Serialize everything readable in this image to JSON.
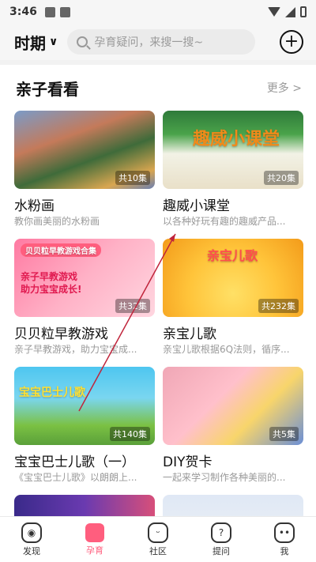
{
  "status": {
    "time": "3:46"
  },
  "topbar": {
    "period_label": "时期",
    "search_placeholder": "孕育疑问，来搜一搜~"
  },
  "section": {
    "title": "亲子看看",
    "more_label": "更多"
  },
  "cards": [
    {
      "title": "水粉画",
      "subtitle": "教你画美丽的水粉画",
      "badge": "共10集"
    },
    {
      "title": "趣威小课堂",
      "subtitle": "以各种好玩有趣的趣威产品...",
      "badge": "共20集",
      "overlay": "趣威小课堂"
    },
    {
      "title": "贝贝粒早教游戏",
      "subtitle": "亲子早教游戏，助力宝宝成...",
      "badge": "共32集",
      "overlay": "亲子早教游戏 助力宝宝成长!",
      "tag": "贝贝粒早教游戏合集"
    },
    {
      "title": "亲宝儿歌",
      "subtitle": "亲宝儿歌根据6Q法则，循序...",
      "badge": "共232集",
      "overlay": "亲宝儿歌"
    },
    {
      "title": "宝宝巴士儿歌（一）",
      "subtitle": "《宝宝巴士儿歌》以朗朗上...",
      "badge": "共140集",
      "overlay": "宝宝巴士儿歌"
    },
    {
      "title": "DIY贺卡",
      "subtitle": "一起来学习制作各种美丽的...",
      "badge": "共5集"
    },
    {
      "title": "",
      "subtitle": "",
      "badge": ""
    },
    {
      "title": "",
      "subtitle": "",
      "badge": ""
    }
  ],
  "bottom_nav": [
    {
      "label": "发现",
      "icon": "compass-icon"
    },
    {
      "label": "孕育",
      "icon": "book-icon",
      "active": true
    },
    {
      "label": "社区",
      "icon": "smile-icon"
    },
    {
      "label": "提问",
      "icon": "question-icon"
    },
    {
      "label": "我",
      "icon": "face-icon"
    }
  ],
  "colors": {
    "accent": "#ff5e7e",
    "background": "#f6f6f6"
  }
}
